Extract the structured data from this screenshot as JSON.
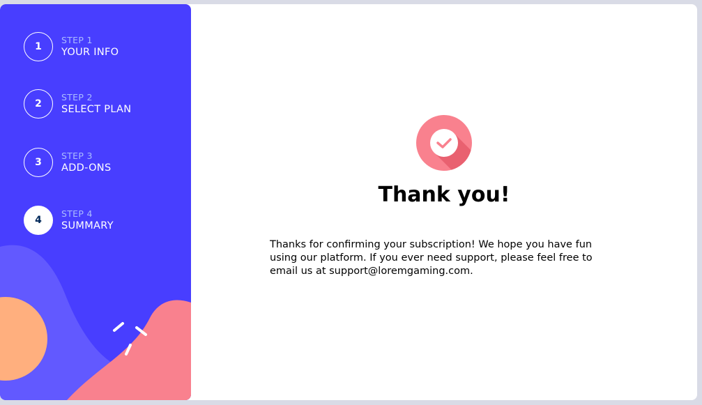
{
  "sidebar": {
    "steps": [
      {
        "number": "1",
        "label": "STEP 1",
        "title": "YOUR INFO",
        "active": false
      },
      {
        "number": "2",
        "label": "STEP 2",
        "title": "SELECT PLAN",
        "active": false
      },
      {
        "number": "3",
        "label": "STEP 3",
        "title": "ADD-ONS",
        "active": false
      },
      {
        "number": "4",
        "label": "STEP 4",
        "title": "SUMMARY",
        "active": true
      }
    ]
  },
  "confirmation": {
    "icon": "checkmark-icon",
    "title": "Thank you!",
    "message": "Thanks for confirming your subscription! We hope you have fun using our platform. If you ever need support, please feel free to email us at support@loremgaming.com."
  },
  "colors": {
    "sidebar_bg": "#483eff",
    "active_step_bg": "#ffffff",
    "step_label": "#abbcff",
    "icon_pink": "#f9818e",
    "decor_orange": "#ffaf7e",
    "decor_purple": "#6259ff"
  }
}
